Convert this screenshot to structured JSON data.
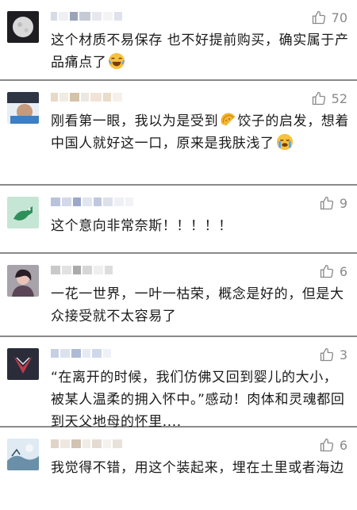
{
  "comments": [
    {
      "likes": "70",
      "text": "这个材质不易保存 也不好提前购买，确实属于产品痛点了",
      "emoji": "laughing-tears-emoji"
    },
    {
      "likes": "52",
      "text_a": "刚看第一眼，我以为是受到",
      "text_b": "饺子的启发，想着中国人就好这一口，原来是我肤浅了",
      "emoji": "crying-emoji",
      "inline_emoji": "taco-emoji"
    },
    {
      "likes": "9",
      "text": "这个意向非常奈斯！！！！！"
    },
    {
      "likes": "6",
      "text": "一花一世界，一叶一枯荣，概念是好的，但是大众接受就不太容易了"
    },
    {
      "likes": "3",
      "text": "“在离开的时候，我们仿佛又回到婴儿的大小，被某人温柔的拥入怀中。”感动！肉体和灵魂都回到天父地母的怀里...."
    },
    {
      "likes": "6",
      "text": "我觉得不错，用这个装起来，埋在土里或者海边"
    }
  ],
  "icons": {
    "like": "thumbs-up-icon"
  },
  "colors": {
    "text": "#1a1a1a",
    "muted": "#8a8a8a",
    "divider": "#8a8a8a"
  }
}
